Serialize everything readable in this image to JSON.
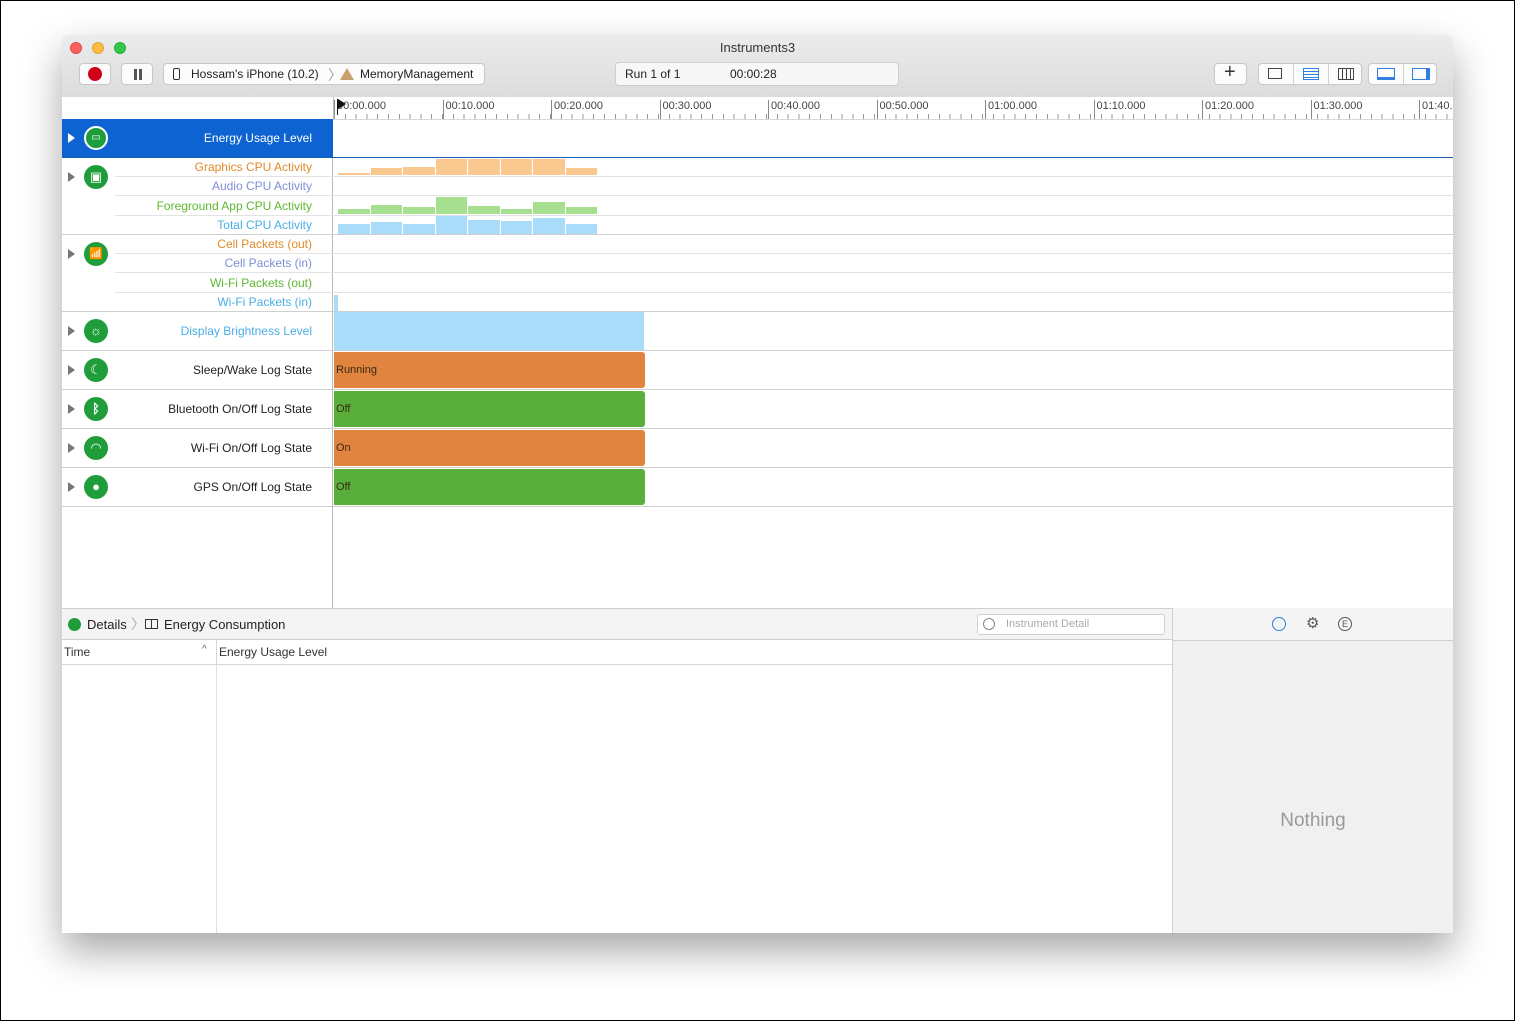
{
  "window": {
    "title": "Instruments3"
  },
  "toolbar": {
    "device": "Hossam's iPhone (10.2)",
    "target": "MemoryManagement",
    "run": "Run 1 of 1",
    "elapsed": "00:00:28"
  },
  "ruler": {
    "ticks": [
      "00:00.000",
      "00:10.000",
      "00:20.000",
      "00:30.000",
      "00:40.000",
      "00:50.000",
      "01:00.000",
      "01:10.000",
      "01:20.000",
      "01:30.000",
      "01:40.0"
    ]
  },
  "tracks": {
    "energy": {
      "label": "Energy Usage Level"
    },
    "cpu": {
      "labels": [
        "Graphics CPU Activity",
        "Audio CPU Activity",
        "Foreground App CPU Activity",
        "Total CPU Activity"
      ],
      "colors": [
        "#e08a2a",
        "#7d8fd6",
        "#5cb82e",
        "#4aaee6"
      ],
      "graphics_levels": [
        0.15,
        0.45,
        0.5,
        1.0,
        1.0,
        1.0,
        1.0,
        0.45
      ],
      "foreground_levels": [
        0.3,
        0.5,
        0.4,
        1.0,
        0.45,
        0.3,
        0.7,
        0.4
      ],
      "total_levels": [
        0.55,
        0.65,
        0.55,
        1.0,
        0.8,
        0.7,
        0.9,
        0.55
      ]
    },
    "network": {
      "labels": [
        "Cell Packets (out)",
        "Cell Packets (in)",
        "Wi-Fi Packets (out)",
        "Wi-Fi Packets (in)"
      ],
      "colors": [
        "#e08a2a",
        "#7d8fd6",
        "#5cb82e",
        "#4aaee6"
      ]
    },
    "brightness": {
      "label": "Display Brightness Level",
      "color": "#4aaee6"
    },
    "sleep": {
      "label": "Sleep/Wake Log State",
      "state": "Running",
      "color": "#e0843f"
    },
    "bluetooth": {
      "label": "Bluetooth On/Off Log State",
      "state": "Off",
      "color": "#5aaf3c"
    },
    "wifi": {
      "label": "Wi-Fi On/Off Log State",
      "state": "On",
      "color": "#e0843f"
    },
    "gps": {
      "label": "GPS On/Off Log State",
      "state": "Off",
      "color": "#5aaf3c"
    }
  },
  "details": {
    "crumb1": "Details",
    "crumb2": "Energy Consumption",
    "filter_placeholder": "Instrument Detail",
    "columns": [
      "Time",
      "Energy Usage Level"
    ]
  },
  "inspector": {
    "empty": "Nothing"
  }
}
